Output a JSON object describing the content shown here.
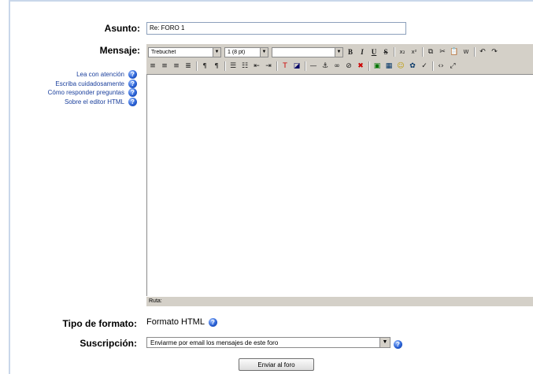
{
  "form": {
    "asunto_label": "Asunto:",
    "asunto_value": "Re: FORO 1",
    "mensaje_label": "Mensaje:",
    "tipo_label": "Tipo de formato:",
    "tipo_value": "Formato HTML",
    "suscripcion_label": "Suscripción:",
    "suscripcion_value": "Enviarme por email los mensajes de este foro",
    "submit_label": "Enviar al foro"
  },
  "help_links": [
    "Lea con atención",
    "Escriba cuidadosamente",
    "Cómo responder preguntas",
    "Sobre el editor HTML"
  ],
  "editor": {
    "font_select": "Trebuchet",
    "size_select": "1 (8 pt)",
    "style_select": "",
    "block_select": "",
    "path_label": "Ruta:"
  },
  "icons": {
    "help": "help-question-icon",
    "dropdown": "chevron-down-icon"
  },
  "colors": {
    "frame": "#c9d7ea",
    "help_link": "#1a3f9c",
    "toolbar_bg": "#d4d0c8"
  }
}
